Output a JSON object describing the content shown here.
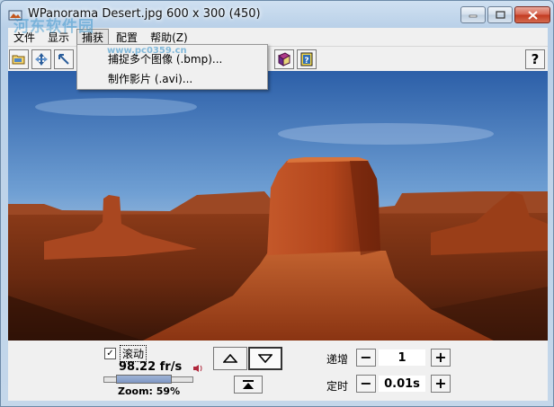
{
  "window": {
    "title": "WPanorama  Desert.jpg   600 x 300 (450)"
  },
  "menubar": {
    "items": [
      "文件",
      "显示",
      "捕获",
      "配置",
      "帮助(Z)"
    ],
    "active_index": 2
  },
  "dropdown": {
    "items": [
      "捕捉多个图像 (.bmp)...",
      "制作影片 (.avi)..."
    ]
  },
  "toolbar": {
    "help_label": "?"
  },
  "panel": {
    "scroll_label": "滚动",
    "scroll_checked": true,
    "fps": "98.22 fr/s",
    "zoom": "Zoom: 59%",
    "increment_label": "递增",
    "increment_value": "1",
    "timer_label": "定时",
    "timer_value": "0.01s",
    "slider_fraction": 0.59
  },
  "watermark": {
    "text": "河东软件园",
    "url": "www.pc0359.cn"
  },
  "colors": {
    "accent": "#3b6ea5",
    "chrome": "#f0f0f0"
  }
}
